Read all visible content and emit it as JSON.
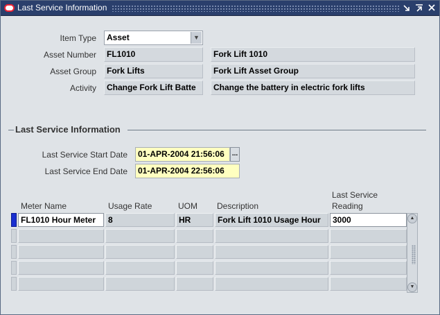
{
  "window": {
    "title": "Last Service Information",
    "controls": [
      "minimize-icon",
      "restore-icon",
      "close-icon"
    ]
  },
  "item": {
    "item_type_label": "Item Type",
    "item_type_value": "Asset",
    "asset_number_label": "Asset Number",
    "asset_number": "FL1010",
    "asset_description": "Fork Lift 1010",
    "asset_group_label": "Asset Group",
    "asset_group": "Fork Lifts",
    "asset_group_description": "Fork Lift Asset Group",
    "activity_label": "Activity",
    "activity": "Change Fork Lift Batte",
    "activity_description": "Change the battery in electric fork lifts"
  },
  "last_service": {
    "section_title": "Last Service Information",
    "start_date_label": "Last Service Start Date",
    "start_date": "01-APR-2004 21:56:06",
    "end_date_label": "Last Service End Date",
    "end_date": "01-APR-2004 22:56:06",
    "lov_label": "..."
  },
  "meter_table": {
    "headers": {
      "meter_name": "Meter Name",
      "usage_rate": "Usage Rate",
      "uom": "UOM",
      "description": "Description",
      "reading_line1": "Last Service",
      "reading_line2": "Reading"
    },
    "rows": [
      {
        "meter_name": "FL1010 Hour Meter",
        "usage_rate": "8",
        "uom": "HR",
        "description": "Fork Lift 1010 Usage Hour",
        "reading": "3000"
      },
      {
        "meter_name": "",
        "usage_rate": "",
        "uom": "",
        "description": "",
        "reading": ""
      },
      {
        "meter_name": "",
        "usage_rate": "",
        "uom": "",
        "description": "",
        "reading": ""
      },
      {
        "meter_name": "",
        "usage_rate": "",
        "uom": "",
        "description": "",
        "reading": ""
      },
      {
        "meter_name": "",
        "usage_rate": "",
        "uom": "",
        "description": "",
        "reading": ""
      }
    ]
  },
  "colors": {
    "titlebar": "#2a3f6c",
    "active_row_indicator": "#1a2fd0",
    "date_field_bg": "#ffffc0"
  }
}
